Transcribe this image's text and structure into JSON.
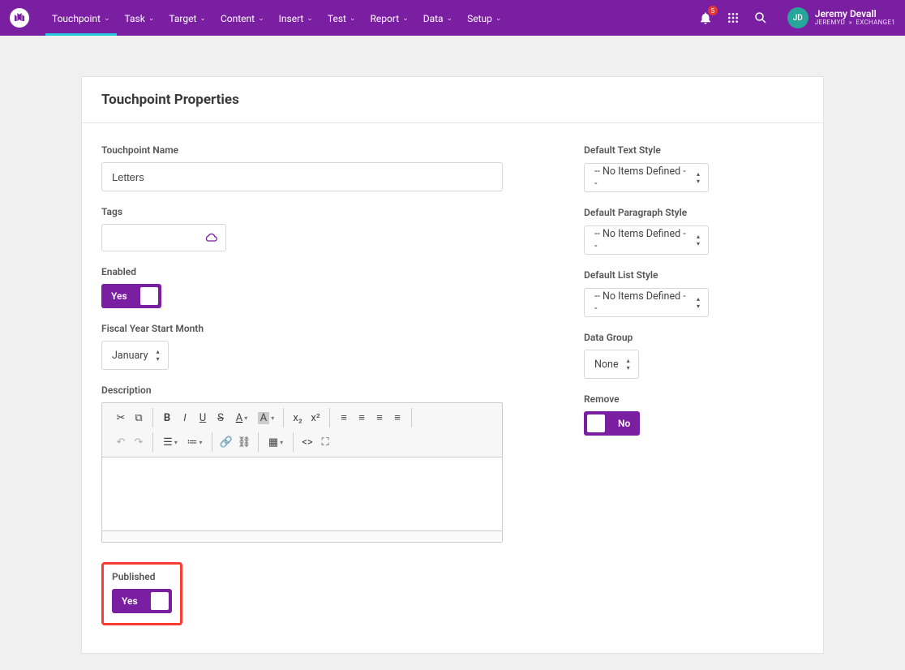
{
  "nav": {
    "items": [
      "Touchpoint",
      "Task",
      "Target",
      "Content",
      "Insert",
      "Test",
      "Report",
      "Data",
      "Setup"
    ],
    "active_index": 0,
    "notification_count": "5"
  },
  "user": {
    "initials": "JD",
    "name": "Jeremy Devall",
    "sub_left": "JEREMYD",
    "sub_right": "EXCHANGE1"
  },
  "page": {
    "title": "Touchpoint Properties"
  },
  "left": {
    "name_label": "Touchpoint Name",
    "name_value": "Letters",
    "tags_label": "Tags",
    "enabled_label": "Enabled",
    "enabled_value": "Yes",
    "fiscal_label": "Fiscal Year Start Month",
    "fiscal_value": "January",
    "description_label": "Description",
    "published_label": "Published",
    "published_value": "Yes"
  },
  "right": {
    "text_style_label": "Default Text Style",
    "text_style_value": "-- No Items Defined --",
    "para_style_label": "Default Paragraph Style",
    "para_style_value": "-- No Items Defined --",
    "list_style_label": "Default List Style",
    "list_style_value": "-- No Items Defined --",
    "data_group_label": "Data Group",
    "data_group_value": "None",
    "remove_label": "Remove",
    "remove_value": "No"
  }
}
